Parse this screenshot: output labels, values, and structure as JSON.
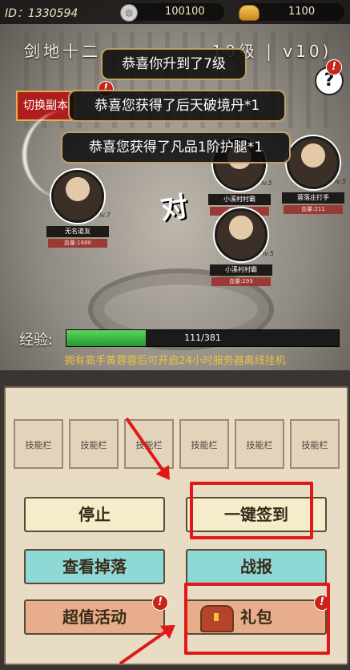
{
  "header": {
    "player_id": "ID：1330594",
    "silver": "100100",
    "gold": "1100",
    "silver_icon": "coin-icon",
    "gold_icon": "gold-ingot-icon"
  },
  "scene": {
    "title": "剑地十二",
    "title_suffix": "10级 | v10)",
    "switch_button": "切换副本",
    "help_symbol": "?",
    "alert_symbol": "!",
    "vs_glyph": "对"
  },
  "toasts": [
    "恭喜你升到了7级",
    "恭喜您获得了后天破境丹*1",
    "恭喜您获得了凡品1阶护腿*1"
  ],
  "characters": {
    "player": {
      "name": "无名道友",
      "hp": "血量:1680",
      "level": "lv.7"
    },
    "enemies": [
      {
        "name": "小溪村村霸",
        "hp": "血量:299",
        "level": "lv.5"
      },
      {
        "name": "蓉落庄打手",
        "hp": "血量:211",
        "level": "lv.5"
      },
      {
        "name": "小溪村村霸",
        "hp": "血量:299",
        "level": "lv.5"
      }
    ]
  },
  "experience": {
    "label": "经验:",
    "value_text": "111/381",
    "fraction": 0.29,
    "tip": "拥有高手黄蓉蓉后可开启24小时服务器离线挂机"
  },
  "skills": [
    "技能栏",
    "技能栏",
    "技能栏",
    "技能栏",
    "技能栏",
    "技能栏"
  ],
  "buttons": {
    "stop": "停止",
    "sign_in": "一键签到",
    "view_drops": "查看掉落",
    "battle_report": "战报",
    "activity": "超值活动",
    "gift": "礼包"
  },
  "colors": {
    "highlight": "#e01818",
    "exp_fill": "#3cc245",
    "tip_text": "#f0c043",
    "teal_button": "#8ed9d6"
  }
}
